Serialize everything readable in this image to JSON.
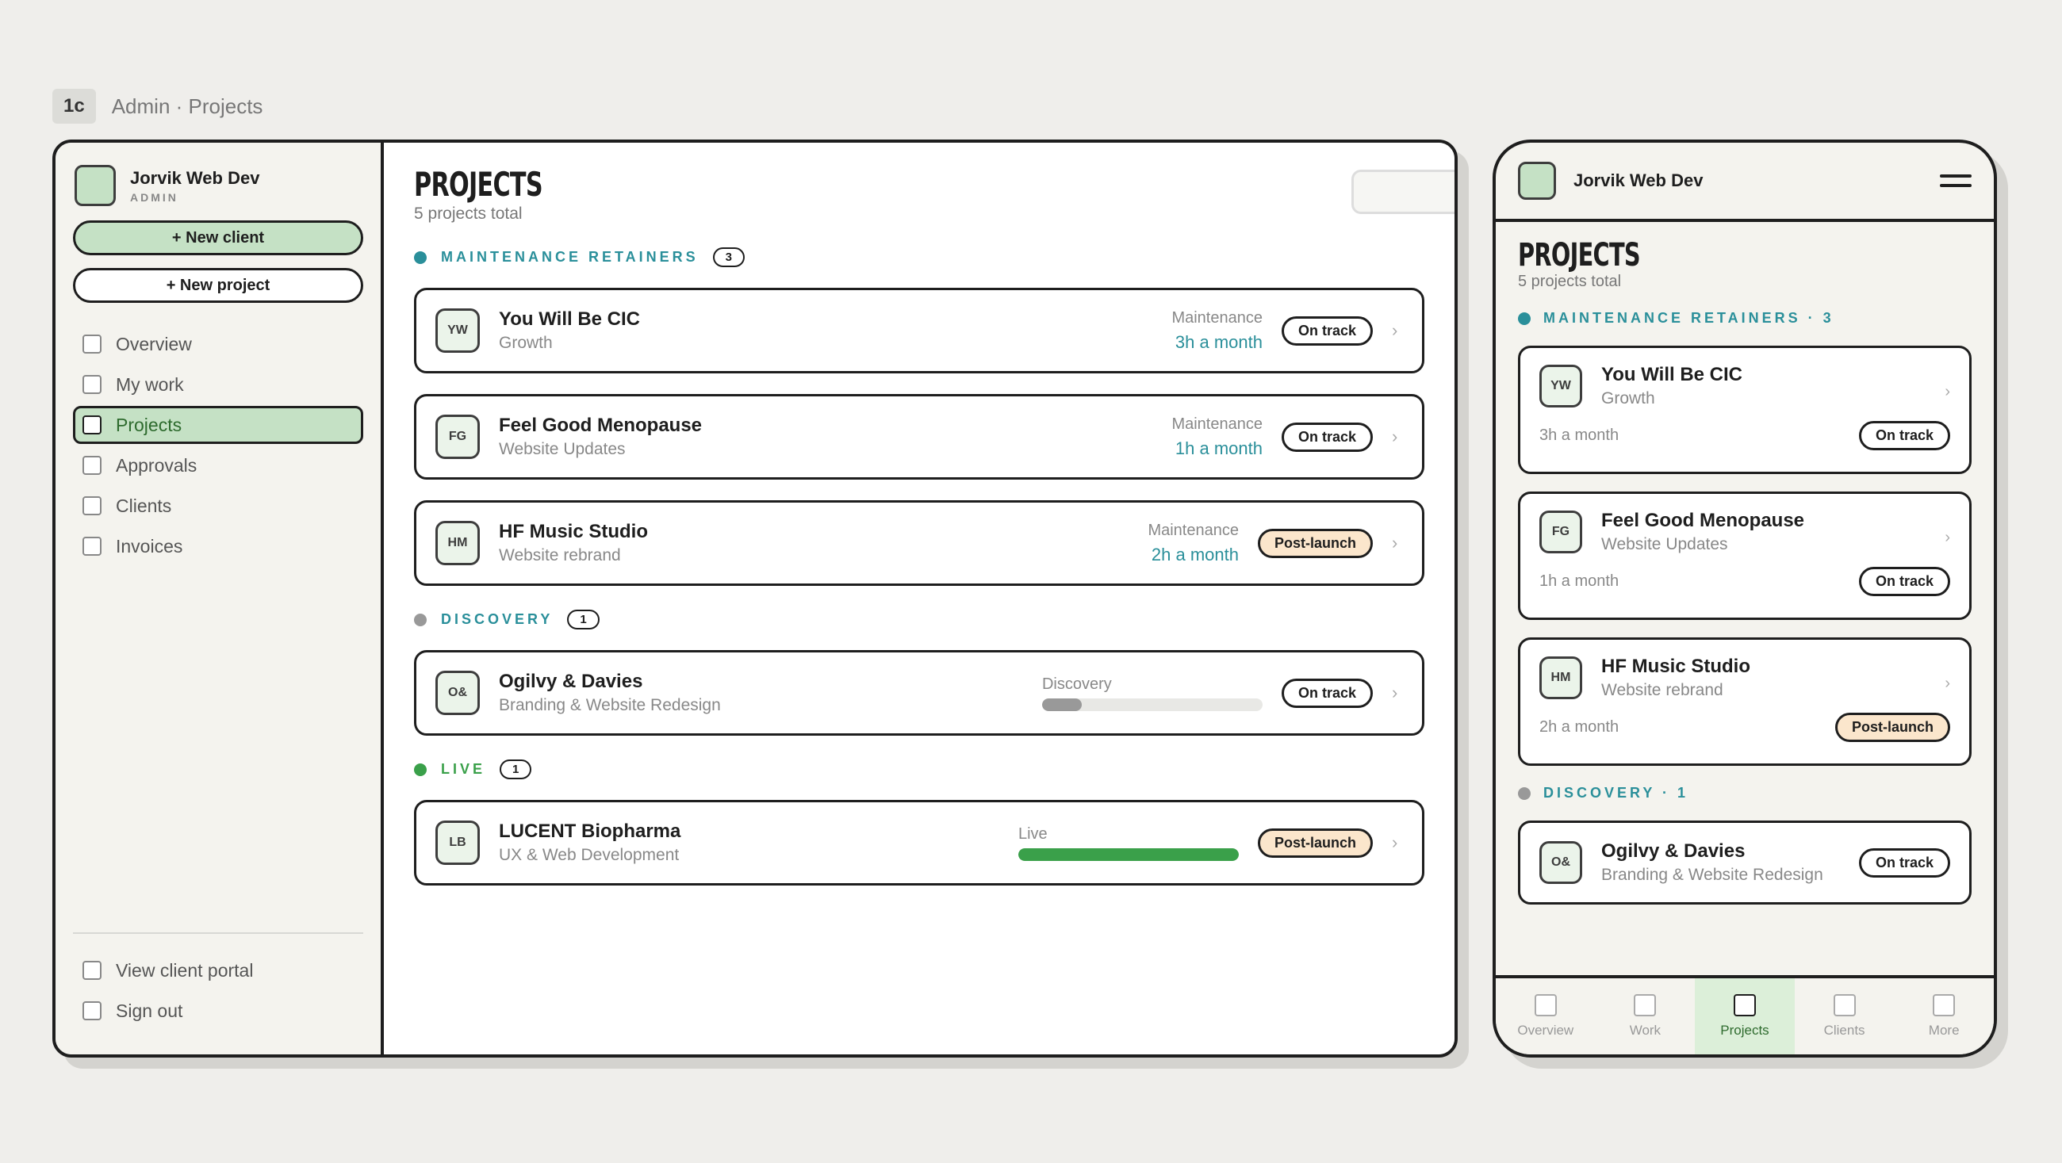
{
  "tag": "1c",
  "breadcrumb": "Admin · Projects",
  "org": {
    "name": "Jorvik Web Dev",
    "role": "ADMIN"
  },
  "actions": {
    "new_client": "+ New client",
    "new_project": "+ New project"
  },
  "nav": [
    "Overview",
    "My work",
    "Projects",
    "Approvals",
    "Clients",
    "Invoices"
  ],
  "footer_nav": [
    "View client portal",
    "Sign out"
  ],
  "page": {
    "title": "PROJECTS",
    "subtitle": "5 projects total"
  },
  "sections": {
    "retainers": {
      "label": "MAINTENANCE RETAINERS",
      "count": "3",
      "mobile_label": "MAINTENANCE RETAINERS · 3",
      "color": "#2a8f9a"
    },
    "discovery": {
      "label": "DISCOVERY",
      "count": "1",
      "mobile_label": "DISCOVERY · 1",
      "color": "#999999"
    },
    "live": {
      "label": "LIVE",
      "count": "1",
      "color": "#3aa04a"
    }
  },
  "projects": [
    {
      "initials": "YW",
      "name": "You Will Be CIC",
      "type": "Growth",
      "meta_label": "Maintenance",
      "hours": "3h a month",
      "status": "On track"
    },
    {
      "initials": "FG",
      "name": "Feel Good Menopause",
      "type": "Website Updates",
      "meta_label": "Maintenance",
      "hours": "1h a month",
      "status": "On track"
    },
    {
      "initials": "HM",
      "name": "HF Music Studio",
      "type": "Website rebrand",
      "meta_label": "Maintenance",
      "hours": "2h a month",
      "status": "Post-launch"
    },
    {
      "initials": "O&",
      "name": "Ogilvy & Davies",
      "type": "Branding & Website Redesign",
      "progress_label": "Discovery",
      "progress": 0.18,
      "progress_color": "#999999",
      "status": "On track"
    },
    {
      "initials": "LB",
      "name": "LUCENT Biopharma",
      "type": "UX & Web Development",
      "progress_label": "Live",
      "progress": 1.0,
      "progress_color": "#3aa04a",
      "status": "Post-launch"
    }
  ],
  "mobile_tabs": [
    "Overview",
    "Work",
    "Projects",
    "Clients",
    "More"
  ],
  "chevron": "›"
}
